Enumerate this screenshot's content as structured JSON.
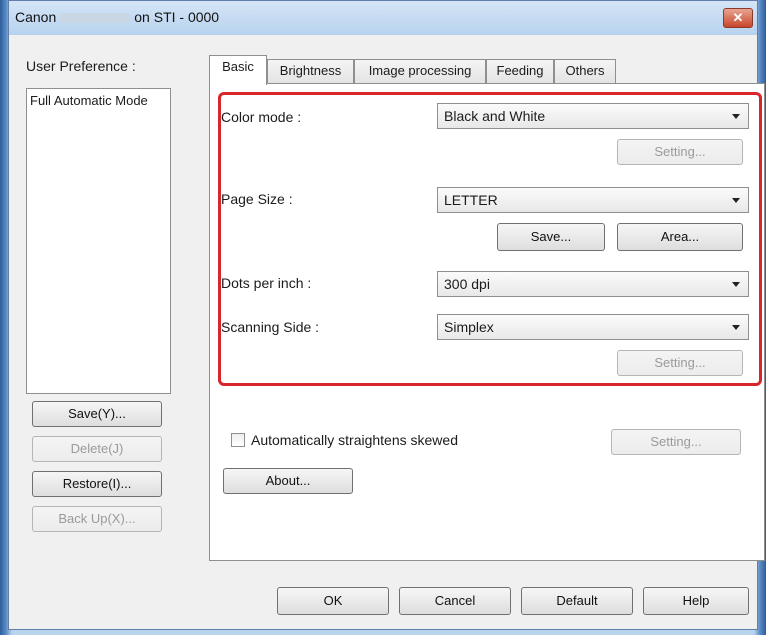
{
  "window": {
    "title_prefix": "Canon",
    "title_suffix": "on STI - 0000",
    "close_symbol": "✕"
  },
  "left_panel": {
    "label": "User Preference :",
    "list_items": [
      "Full Automatic Mode"
    ],
    "buttons": {
      "save": "Save(Y)...",
      "delete": "Delete(J)",
      "restore": "Restore(I)...",
      "backup": "Back Up(X)..."
    }
  },
  "tabs": [
    "Basic",
    "Brightness",
    "Image processing",
    "Feeding",
    "Others"
  ],
  "basic": {
    "color_mode_label": "Color mode :",
    "color_mode_value": "Black and White",
    "color_setting_button": "Setting...",
    "page_size_label": "Page Size :",
    "page_size_value": "LETTER",
    "save_button": "Save...",
    "area_button": "Area...",
    "dpi_label": "Dots per inch :",
    "dpi_value": "300 dpi",
    "scanning_side_label": "Scanning Side :",
    "scanning_side_value": "Simplex",
    "side_setting_button": "Setting...",
    "straighten_label": "Automatically straightens skewed",
    "straighten_setting_button": "Setting...",
    "about_button": "About..."
  },
  "footer": {
    "ok": "OK",
    "cancel": "Cancel",
    "default": "Default",
    "help": "Help"
  },
  "colors": {
    "highlight": "#d9262c",
    "close_button": "#c8452a"
  }
}
